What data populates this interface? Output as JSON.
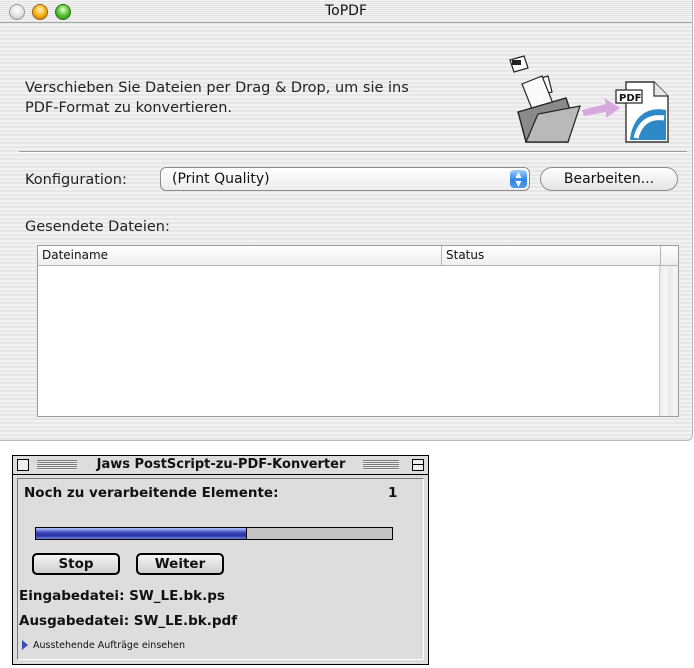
{
  "window": {
    "title": "ToPDF",
    "instructions_line1": "Verschieben Sie Dateien per Drag & Drop, um sie ins",
    "instructions_line2": "PDF-Format zu konvertieren.",
    "pdf_badge": "PDF",
    "config_label": "Konfiguration:",
    "config_value": "(Print Quality)",
    "edit_button": "Bearbeiten...",
    "sent_files_label": "Gesendete Dateien:",
    "table": {
      "columns": [
        "Dateiname",
        "Status"
      ],
      "rows": []
    }
  },
  "converter": {
    "title": "Jaws PostScript-zu-PDF-Konverter",
    "remaining_label": "Noch zu verarbeitende Elemente:",
    "remaining_count": "1",
    "progress_fraction": 0.59,
    "stop_button": "Stop",
    "continue_button": "Weiter",
    "input_file": "Eingabedatei:  SW_LE.bk.ps",
    "output_file": "Ausgabedatei:  SW_LE.bk.pdf",
    "pending_jobs_link": "Ausstehende Aufträge einsehen"
  },
  "colors": {
    "accent_blue": "#2f83e8",
    "progress_blue": "#2a35a0",
    "arrow_pink": "#d9a7df"
  },
  "icons": [
    "close-light",
    "minimize-light",
    "zoom-light",
    "drag-drop-art",
    "pdf-document-icon",
    "popup-arrows-icon",
    "disclosure-triangle-icon"
  ]
}
